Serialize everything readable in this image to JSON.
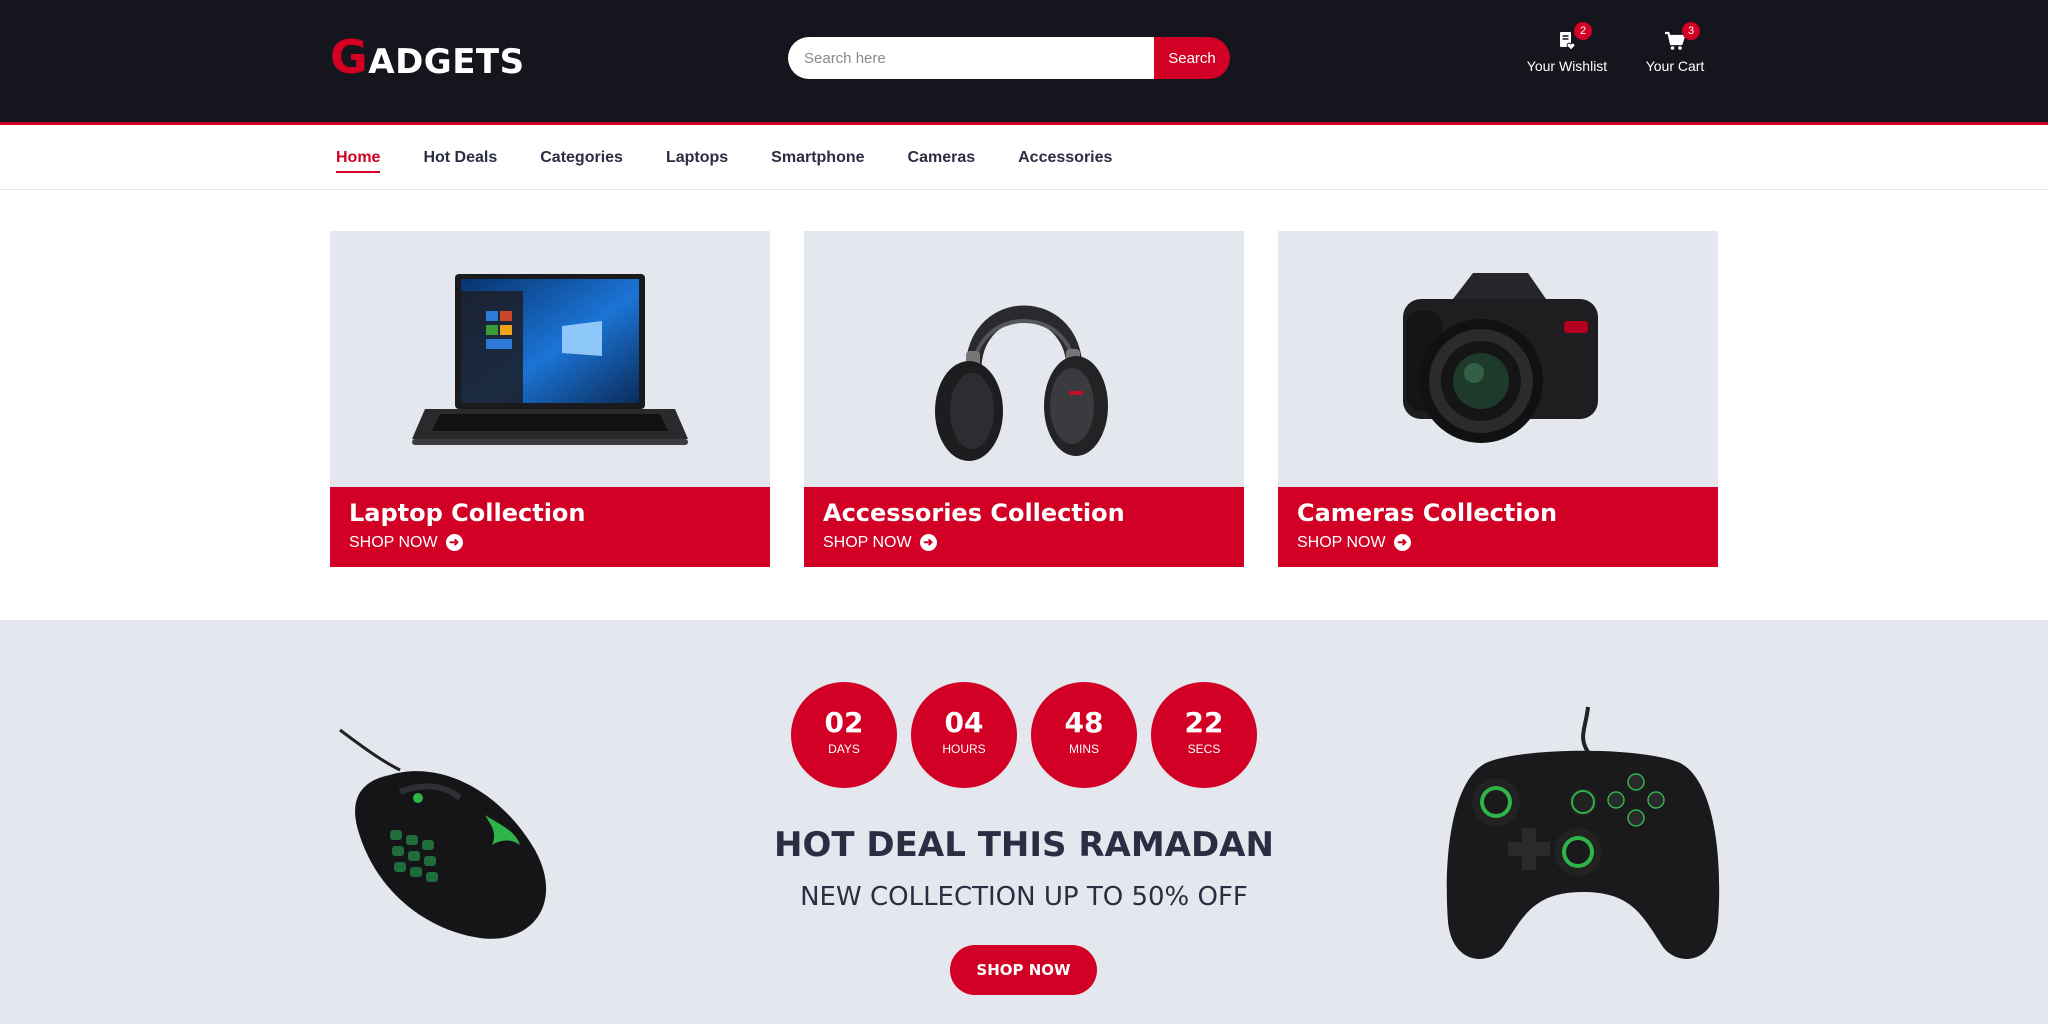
{
  "header": {
    "logo_first": "G",
    "logo_rest": "ADGETS",
    "search_placeholder": "Search here",
    "search_button": "Search",
    "wishlist_label": "Your Wishlist",
    "wishlist_count": "2",
    "cart_label": "Your Cart",
    "cart_count": "3"
  },
  "nav": {
    "items": [
      "Home",
      "Hot Deals",
      "Categories",
      "Laptops",
      "Smartphone",
      "Cameras",
      "Accessories"
    ],
    "active": "Home"
  },
  "collections": [
    {
      "title": "Laptop Collection",
      "cta": "SHOP NOW"
    },
    {
      "title": "Accessories Collection",
      "cta": "SHOP NOW"
    },
    {
      "title": "Cameras Collection",
      "cta": "SHOP NOW"
    }
  ],
  "deal": {
    "countdown": [
      {
        "value": "02",
        "unit": "DAYS"
      },
      {
        "value": "04",
        "unit": "HOURS"
      },
      {
        "value": "48",
        "unit": "MINS"
      },
      {
        "value": "22",
        "unit": "SECS"
      }
    ],
    "title": "HOT DEAL THIS RAMADAN",
    "subtitle": "NEW COLLECTION UP TO 50% OFF",
    "button": "SHOP NOW"
  },
  "colors": {
    "brand": "#d10024",
    "header_bg": "#15161d",
    "panel_bg": "#e4e7ed"
  }
}
